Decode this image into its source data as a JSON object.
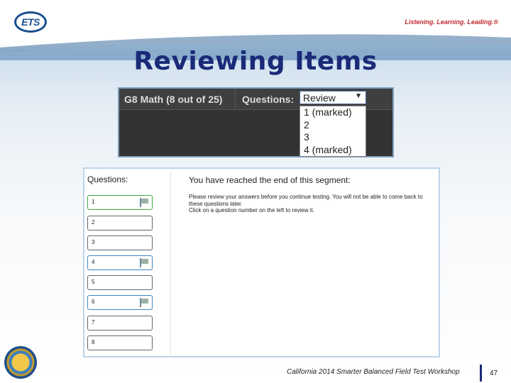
{
  "header": {
    "logo_text": "ETS",
    "tagline": "Listening. Learning. Leading.®"
  },
  "slide": {
    "title": "Reviewing Items"
  },
  "top_screenshot": {
    "test_name": "G8 Math (8 out of 25)",
    "questions_label": "Questions:",
    "select_value": "Review",
    "options": [
      "1 (marked)",
      "2",
      "3",
      "4 (marked)"
    ]
  },
  "bottom_screenshot": {
    "questions_header": "Questions:",
    "questions": [
      {
        "label": "1",
        "state": "current",
        "flagged": true
      },
      {
        "label": "2",
        "state": "normal",
        "flagged": false
      },
      {
        "label": "3",
        "state": "normal",
        "flagged": false
      },
      {
        "label": "4",
        "state": "marked",
        "flagged": true
      },
      {
        "label": "5",
        "state": "normal",
        "flagged": false
      },
      {
        "label": "6",
        "state": "marked",
        "flagged": true
      },
      {
        "label": "7",
        "state": "normal",
        "flagged": false
      },
      {
        "label": "8",
        "state": "normal",
        "flagged": false
      }
    ],
    "content_title": "You have reached the end of this segment:",
    "content_line1": "Please review your answers before you continue testing. You will not be able to come back to these questions later.",
    "content_line2": "Click on a question number on the left to review it."
  },
  "footer": {
    "workshop_text": "California 2014 Smarter Balanced Field Test Workshop",
    "page_number": "47"
  },
  "colors": {
    "title": "#1b2a78",
    "ets_blue": "#1a4f8f",
    "tagline_red": "#c0282d",
    "current_green": "#3caa3c",
    "marked_blue": "#3e86c6"
  }
}
